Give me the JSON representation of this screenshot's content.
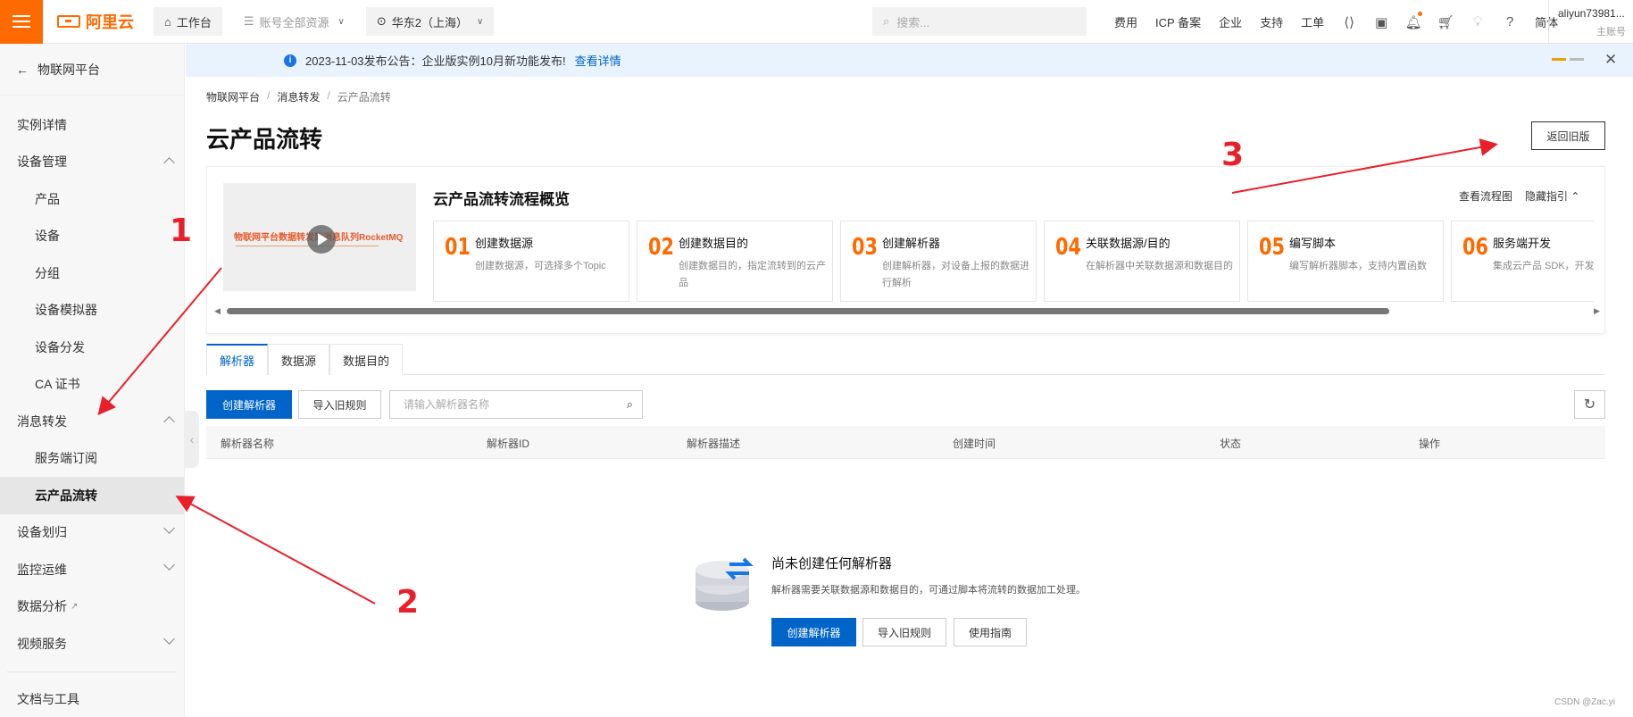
{
  "topbar": {
    "logo_text": "阿里云",
    "workbench": "工作台",
    "resources": "账号全部资源",
    "region": "华东2（上海）",
    "search_placeholder": "搜索...",
    "links": [
      "费用",
      "ICP 备案",
      "企业",
      "支持",
      "工单"
    ],
    "lang": "简体",
    "account_name": "aliyun73981...",
    "account_role": "主账号",
    "brand_color": "#ff6a00"
  },
  "sidebar": {
    "back_label": "物联网平台",
    "items": [
      {
        "label": "实例详情"
      },
      {
        "label": "设备管理"
      },
      {
        "label": "产品"
      },
      {
        "label": "设备"
      },
      {
        "label": "分组"
      },
      {
        "label": "设备模拟器"
      },
      {
        "label": "设备分发"
      },
      {
        "label": "CA 证书"
      },
      {
        "label": "消息转发"
      },
      {
        "label": "服务端订阅"
      },
      {
        "label": "云产品流转"
      },
      {
        "label": "设备划归"
      },
      {
        "label": "监控运维"
      },
      {
        "label": "数据分析"
      },
      {
        "label": "视频服务"
      },
      {
        "label": "文档与工具"
      }
    ]
  },
  "notice": {
    "text": "2023-11-03发布公告：企业版实例10月新功能发布!",
    "link": "查看详情"
  },
  "breadcrumb": [
    "物联网平台",
    "消息转发",
    "云产品流转"
  ],
  "page": {
    "title": "云产品流转",
    "back_old_version": "返回旧版"
  },
  "guide": {
    "video_text": "物联网平台数据转发到消息队列RocketMQ",
    "title": "云产品流转流程概览",
    "view_flowchart": "查看流程图",
    "hide_guide": "隐藏指引",
    "steps": [
      {
        "num": "01",
        "title": "创建数据源",
        "desc": "创建数据源，可选择多个Topic"
      },
      {
        "num": "02",
        "title": "创建数据目的",
        "desc": "创建数据目的，指定流转到的云产品"
      },
      {
        "num": "03",
        "title": "创建解析器",
        "desc": "创建解析器，对设备上报的数据进行解析"
      },
      {
        "num": "04",
        "title": "关联数据源/目的",
        "desc": "在解析器中关联数据源和数据目的"
      },
      {
        "num": "05",
        "title": "编写脚本",
        "desc": "编写解析器脚本，支持内置函数"
      },
      {
        "num": "06",
        "title": "服务端开发",
        "desc": "集成云产品 SDK，开发程序"
      }
    ]
  },
  "tabs": [
    "解析器",
    "数据源",
    "数据目的"
  ],
  "toolbar": {
    "create_parser": "创建解析器",
    "import_old_rules": "导入旧规则",
    "search_placeholder": "请输入解析器名称"
  },
  "table": {
    "columns": [
      "解析器名称",
      "解析器ID",
      "解析器描述",
      "创建时间",
      "状态",
      "操作"
    ]
  },
  "empty": {
    "title": "尚未创建任何解析器",
    "desc": "解析器需要关联数据源和数据目的，可通过脚本将流转的数据加工处理。",
    "create_parser": "创建解析器",
    "import_old_rules": "导入旧规则",
    "usage_guide": "使用指南"
  },
  "annotations": {
    "marker_1": "1",
    "marker_2": "2",
    "marker_3": "3",
    "color": "#e8202a"
  },
  "watermark": "CSDN @Zac.yi",
  "primary_color": "#0064c8"
}
